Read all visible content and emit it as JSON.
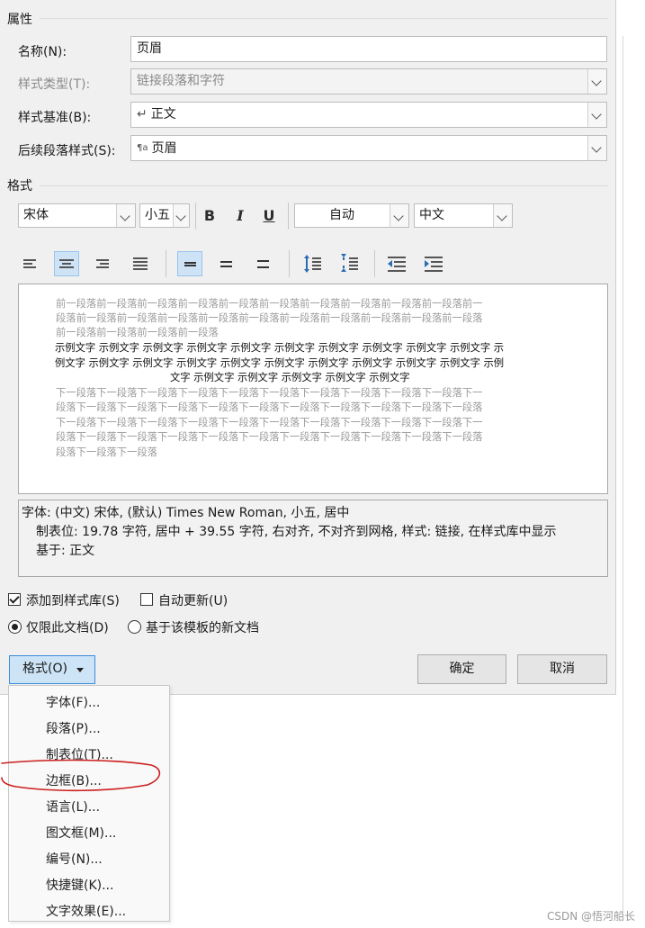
{
  "properties": {
    "title": "属性",
    "name_label": "名称(N):",
    "name_value": "页眉",
    "type_label": "样式类型(T):",
    "type_value": "链接段落和字符",
    "based_label": "样式基准(B):",
    "based_value": "正文",
    "based_icon": "↵",
    "next_label": "后续段落样式(S):",
    "next_value": "页眉",
    "next_icon": "¶a"
  },
  "format_section": {
    "title": "格式",
    "font": "宋体",
    "size": "小五",
    "bold": "B",
    "italic": "I",
    "underline": "U",
    "color": "自动",
    "script": "中文"
  },
  "preview": {
    "prev_para": [
      "前一段落前一段落前一段落前一段落前一段落前一段落前一段落前一段落前一段落前一段落前一",
      "段落前一段落前一段落前一段落前一段落前一段落前一段落前一段落前一段落前一段落前一段落",
      "前一段落前一段落前一段落前一段落"
    ],
    "sample": [
      "示例文字 示例文字 示例文字 示例文字 示例文字 示例文字 示例文字 示例文字 示例文字 示例文字 示",
      "例文字 示例文字 示例文字 示例文字 示例文字 示例文字 示例文字 示例文字 示例文字 示例文字 示例",
      "文字 示例文字 示例文字 示例文字 示例文字 示例文字"
    ],
    "next_para": [
      "下一段落下一段落下一段落下一段落下一段落下一段落下一段落下一段落下一段落下一段落下一",
      "段落下一段落下一段落下一段落下一段落下一段落下一段落下一段落下一段落下一段落下一段落",
      "下一段落下一段落下一段落下一段落下一段落下一段落下一段落下一段落下一段落下一段落下一",
      "段落下一段落下一段落下一段落下一段落下一段落下一段落下一段落下一段落下一段落下一段落",
      "段落下一段落下一段落"
    ]
  },
  "description": {
    "line1": "字体: (中文) 宋体, (默认) Times New Roman, 小五, 居中",
    "line2": "制表位: 19.78 字符, 居中 +  39.55 字符, 右对齐, 不对齐到网格, 样式: 链接, 在样式库中显示",
    "line3": "基于: 正文"
  },
  "options": {
    "add_gallery": "添加到样式库(S)",
    "add_gallery_checked": true,
    "auto_update": "自动更新(U)",
    "auto_update_checked": false,
    "only_doc": "仅限此文档(D)",
    "only_doc_selected": true,
    "new_docs": "基于该模板的新文档",
    "new_docs_selected": false
  },
  "buttons": {
    "format": "格式(O)",
    "ok": "确定",
    "cancel": "取消"
  },
  "format_menu": {
    "items": [
      "字体(F)...",
      "段落(P)...",
      "制表位(T)...",
      "边框(B)...",
      "语言(L)...",
      "图文框(M)...",
      "编号(N)...",
      "快捷键(K)...",
      "文字效果(E)..."
    ],
    "annotation_color": "#cc1f1f"
  },
  "watermark": "CSDN @悟河船长"
}
